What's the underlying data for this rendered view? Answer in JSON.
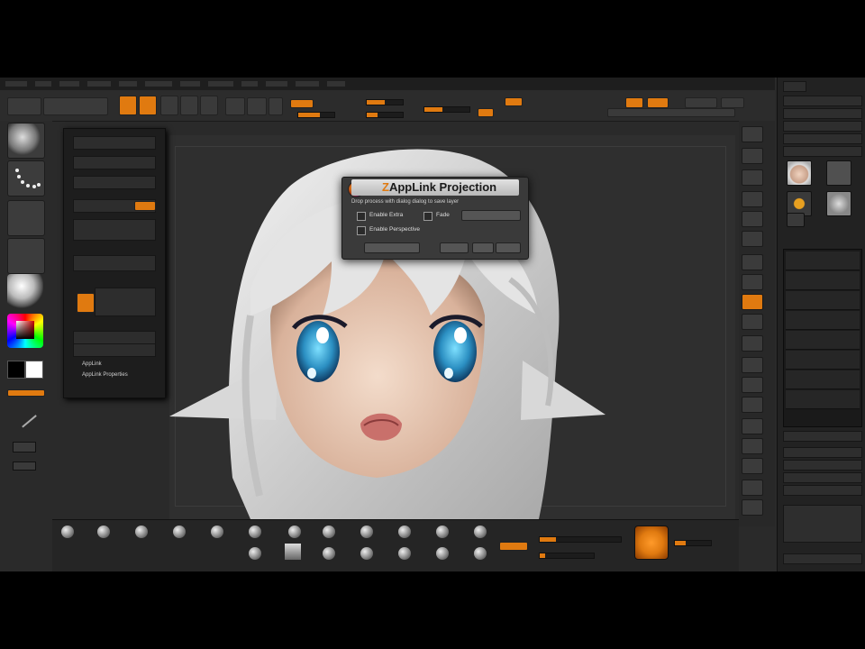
{
  "dialog": {
    "title_prefix": "Z",
    "title": "AppLink Projection",
    "subtitle": "Drop process with dialog dialog to save layer",
    "option_enable_extra": "Enable Extra",
    "option_enable_perspective": "Enable Perspective",
    "fade_label": "Fade",
    "palette_item_1": "AppLink",
    "palette_item_2": "AppLink Properties"
  },
  "colors": {
    "accent": "#e07a10",
    "panel": "#1d1d1d",
    "canvas": "#2f2f2f",
    "hair": "#dcdcdc",
    "skin": "#eed1bd",
    "eye": "#2e97c6"
  },
  "icons": {
    "app_logo": "zbrush-logo-icon",
    "brush": "brush-sphere-icon",
    "stroke": "dots-stroke-icon",
    "material": "material-sphere-icon",
    "color_picker": "color-picker-icon"
  }
}
